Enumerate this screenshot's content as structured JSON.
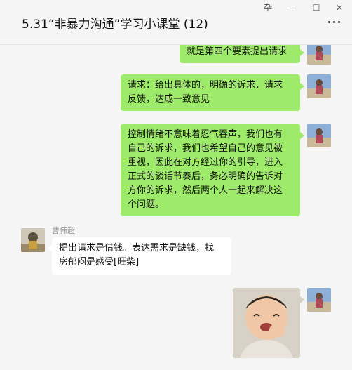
{
  "window": {
    "title": "5.31“非暴力沟通”学习小课堂 (12)",
    "controls": {
      "pin": "卆",
      "minimize": "—",
      "maximize": "☐",
      "close": "✕"
    }
  },
  "messages": [
    {
      "from": "me",
      "lines": [
        "就是第四个要素提出请求"
      ]
    },
    {
      "from": "me",
      "lines": [
        "请求：给出具体的，明确的诉求，请求",
        "反馈，达成一致意见"
      ]
    },
    {
      "from": "me",
      "lines": [
        "控制情绪不意味着忍气吞声，我们也有",
        "自己的诉求，我们也希望自己的意见被",
        "重视，因此在对方经过你的引导，进入",
        "正式的谈话节奏后，务必明确的告诉对",
        "方你的诉求，然后两个人一起来解决这",
        "个问题。"
      ]
    },
    {
      "from": "other",
      "sender": "曹伟超",
      "lines": [
        "提出请求是借钱。表达需求是缺钱，找",
        "房郁闷是感受[旺柴]"
      ]
    },
    {
      "from": "me",
      "type": "image",
      "description_icon": "baby-laughing-photo"
    }
  ],
  "colors": {
    "my_bubble": "#9eea6a",
    "their_bubble": "#ffffff",
    "background": "#f5f5f5"
  }
}
